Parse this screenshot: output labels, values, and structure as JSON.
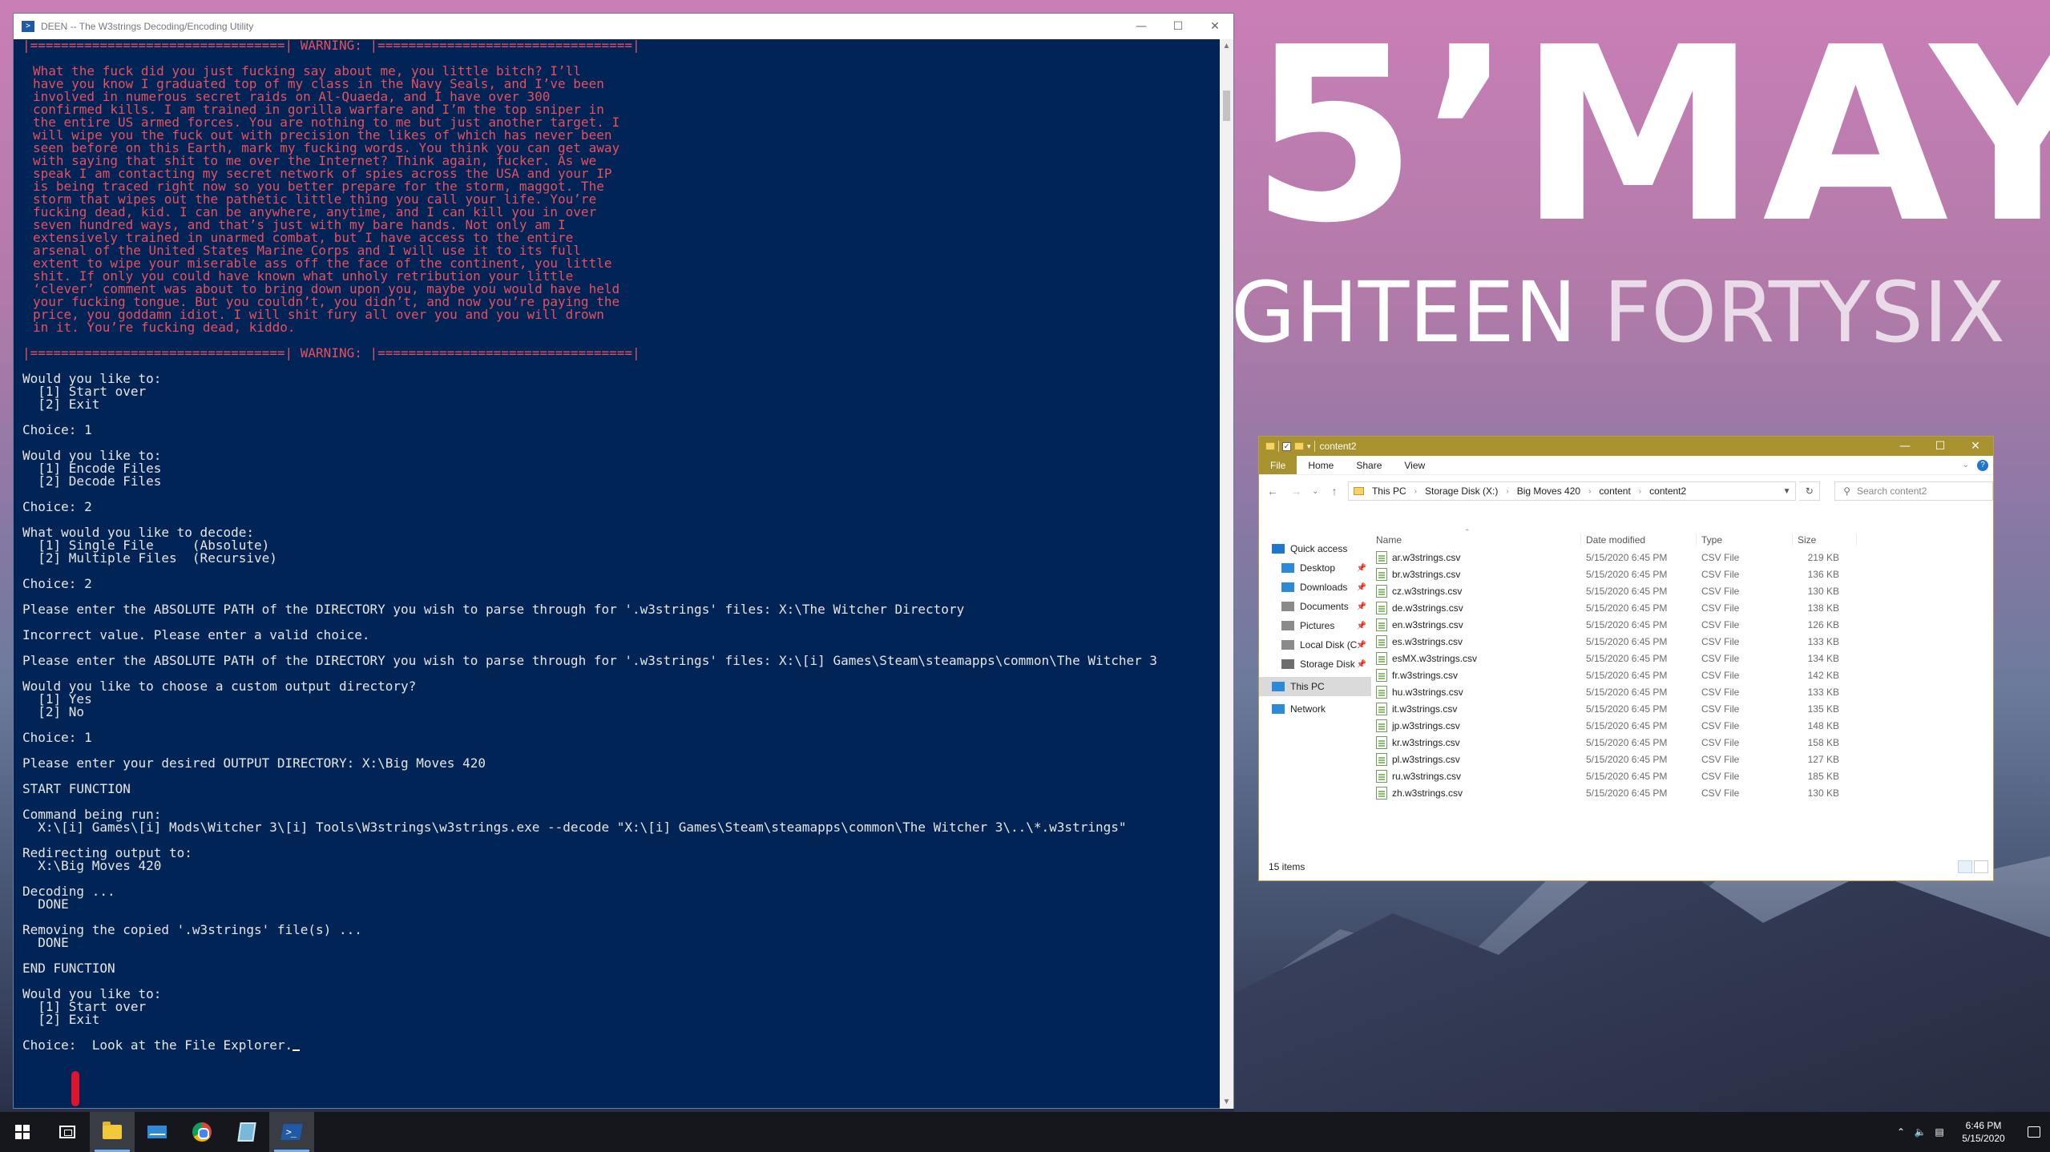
{
  "wallpaper": {
    "title": "5’MAY",
    "subtitle_bold": "GHTEEN",
    "subtitle_light": "FORTYSIX"
  },
  "console": {
    "title": "DEEN -- The W3strings Decoding/Encoding Utility",
    "terminal_lines": {
      "warn_top": "|=================================| WARNING: |=================================|",
      "rant": [
        "What the fuck did you just fucking say about me, you little bitch? I’ll",
        "have you know I graduated top of my class in the Navy Seals, and I’ve been",
        "involved in numerous secret raids on Al-Quaeda, and I have over 300",
        "confirmed kills. I am trained in gorilla warfare and I’m the top sniper in",
        "the entire US armed forces. You are nothing to me but just another target. I",
        "will wipe you the fuck out with precision the likes of which has never been",
        "seen before on this Earth, mark my fucking words. You think you can get away",
        "with saying that shit to me over the Internet? Think again, fucker. As we",
        "speak I am contacting my secret network of spies across the USA and your IP",
        "is being traced right now so you better prepare for the storm, maggot. The",
        "storm that wipes out the pathetic little thing you call your life. You’re",
        "fucking dead, kid. I can be anywhere, anytime, and I can kill you in over",
        "seven hundred ways, and that’s just with my bare hands. Not only am I",
        "extensively trained in unarmed combat, but I have access to the entire",
        "arsenal of the United States Marine Corps and I will use it to its full",
        "extent to wipe your miserable ass off the face of the continent, you little",
        "shit. If only you could have known what unholy retribution your little",
        "‘clever’ comment was about to bring down upon you, maybe you would have held",
        "your fucking tongue. But you couldn’t, you didn’t, and now you’re paying the",
        "price, you goddamn idiot. I will shit fury all over you and you will drown",
        "in it. You’re fucking dead, kiddo."
      ],
      "warn_bottom": "|=================================| WARNING: |=================================|",
      "blocks": [
        [
          "Would you like to:",
          "  [1] Start over",
          "  [2] Exit"
        ],
        [
          "Choice: 1"
        ],
        [
          "Would you like to:",
          "  [1] Encode Files",
          "  [2] Decode Files"
        ],
        [
          "Choice: 2"
        ],
        [
          "What would you like to decode:",
          "  [1] Single File     (Absolute)",
          "  [2] Multiple Files  (Recursive)"
        ],
        [
          "Choice: 2"
        ],
        [
          "Please enter the ABSOLUTE PATH of the DIRECTORY you wish to parse through for '.w3strings' files: X:\\The Witcher Directory"
        ],
        [
          "Incorrect value. Please enter a valid choice."
        ],
        [
          "Please enter the ABSOLUTE PATH of the DIRECTORY you wish to parse through for '.w3strings' files: X:\\[i] Games\\Steam\\steamapps\\common\\The Witcher 3"
        ],
        [
          "Would you like to choose a custom output directory?",
          "  [1] Yes",
          "  [2] No"
        ],
        [
          "Choice: 1"
        ],
        [
          "Please enter your desired OUTPUT DIRECTORY: X:\\Big Moves 420"
        ],
        [
          "START FUNCTION"
        ],
        [
          "Command being run:",
          "  X:\\[i] Games\\[i] Mods\\Witcher 3\\[i] Tools\\W3strings\\w3strings.exe --decode \"X:\\[i] Games\\Steam\\steamapps\\common\\The Witcher 3\\..\\*.w3strings\""
        ],
        [
          "Redirecting output to:",
          "  X:\\Big Moves 420"
        ],
        [
          "Decoding ...",
          "  DONE"
        ],
        [
          "Removing the copied '.w3strings' file(s) ...",
          "  DONE"
        ],
        [
          "END FUNCTION"
        ],
        [
          "Would you like to:",
          "  [1] Start over",
          "  [2] Exit"
        ]
      ],
      "prompt": "Choice: ",
      "input_text": " Look at the File Explorer."
    }
  },
  "explorer": {
    "title": "content2",
    "ribbon_tabs": [
      "File",
      "Home",
      "Share",
      "View"
    ],
    "breadcrumbs": [
      "This PC",
      "Storage Disk (X:)",
      "Big Moves 420",
      "content",
      "content2"
    ],
    "search_placeholder": "Search content2",
    "nav": [
      {
        "label": "Quick access",
        "color": "#1f76cf",
        "pinned": false
      },
      {
        "label": "Desktop",
        "color": "#2b8bd8",
        "pinned": true
      },
      {
        "label": "Downloads",
        "color": "#2b8bd8",
        "pinned": true
      },
      {
        "label": "Documents",
        "color": "#8a8a8a",
        "pinned": true
      },
      {
        "label": "Pictures",
        "color": "#8a8a8a",
        "pinned": true
      },
      {
        "label": "Local Disk (C:",
        "color": "#8a8a8a",
        "pinned": true
      },
      {
        "label": "Storage Disk",
        "color": "#6d6d6d",
        "pinned": true
      },
      {
        "label": "This PC",
        "color": "#2b8bd8",
        "pinned": false
      },
      {
        "label": "Network",
        "color": "#2b8bd8",
        "pinned": false
      }
    ],
    "columns": {
      "name": "Name",
      "date": "Date modified",
      "type": "Type",
      "size": "Size"
    },
    "files": [
      {
        "name": "ar.w3strings.csv",
        "date": "5/15/2020 6:45 PM",
        "type": "CSV File",
        "size": "219 KB"
      },
      {
        "name": "br.w3strings.csv",
        "date": "5/15/2020 6:45 PM",
        "type": "CSV File",
        "size": "136 KB"
      },
      {
        "name": "cz.w3strings.csv",
        "date": "5/15/2020 6:45 PM",
        "type": "CSV File",
        "size": "130 KB"
      },
      {
        "name": "de.w3strings.csv",
        "date": "5/15/2020 6:45 PM",
        "type": "CSV File",
        "size": "138 KB"
      },
      {
        "name": "en.w3strings.csv",
        "date": "5/15/2020 6:45 PM",
        "type": "CSV File",
        "size": "126 KB"
      },
      {
        "name": "es.w3strings.csv",
        "date": "5/15/2020 6:45 PM",
        "type": "CSV File",
        "size": "133 KB"
      },
      {
        "name": "esMX.w3strings.csv",
        "date": "5/15/2020 6:45 PM",
        "type": "CSV File",
        "size": "134 KB"
      },
      {
        "name": "fr.w3strings.csv",
        "date": "5/15/2020 6:45 PM",
        "type": "CSV File",
        "size": "142 KB"
      },
      {
        "name": "hu.w3strings.csv",
        "date": "5/15/2020 6:45 PM",
        "type": "CSV File",
        "size": "133 KB"
      },
      {
        "name": "it.w3strings.csv",
        "date": "5/15/2020 6:45 PM",
        "type": "CSV File",
        "size": "135 KB"
      },
      {
        "name": "jp.w3strings.csv",
        "date": "5/15/2020 6:45 PM",
        "type": "CSV File",
        "size": "148 KB"
      },
      {
        "name": "kr.w3strings.csv",
        "date": "5/15/2020 6:45 PM",
        "type": "CSV File",
        "size": "158 KB"
      },
      {
        "name": "pl.w3strings.csv",
        "date": "5/15/2020 6:45 PM",
        "type": "CSV File",
        "size": "127 KB"
      },
      {
        "name": "ru.w3strings.csv",
        "date": "5/15/2020 6:45 PM",
        "type": "CSV File",
        "size": "185 KB"
      },
      {
        "name": "zh.w3strings.csv",
        "date": "5/15/2020 6:45 PM",
        "type": "CSV File",
        "size": "130 KB"
      }
    ],
    "status": "15 items"
  },
  "taskbar": {
    "time": "6:46 PM",
    "date": "5/15/2020",
    "apps": [
      "start-icon",
      "task-view-icon",
      "file-explorer-icon",
      "mail-icon",
      "chrome-icon",
      "notes-icon",
      "powershell-icon"
    ]
  }
}
